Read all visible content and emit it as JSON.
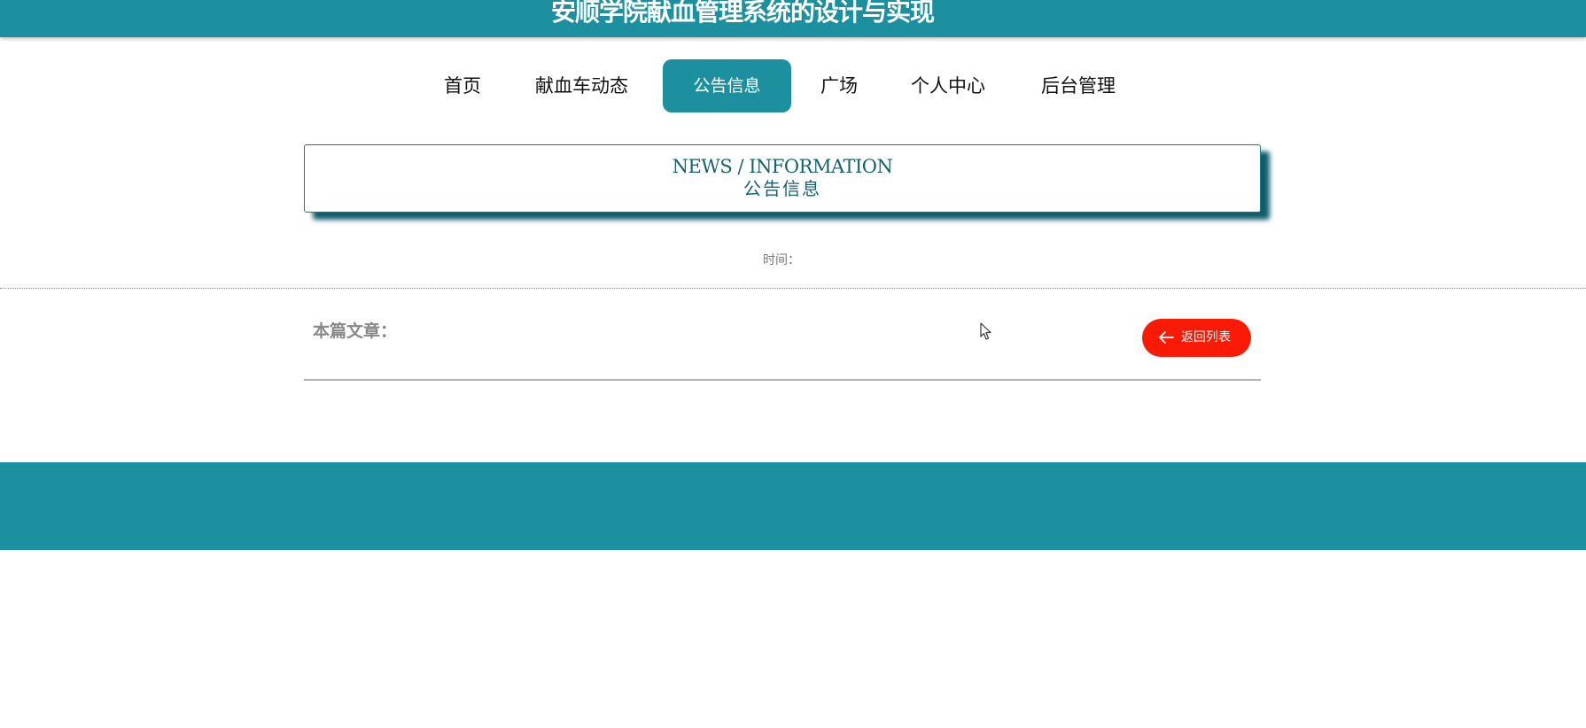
{
  "header": {
    "title": "安顺学院献血管理系统的设计与实现"
  },
  "nav": {
    "items": [
      {
        "label": "首页"
      },
      {
        "label": "献血车动态"
      },
      {
        "label": "公告信息",
        "active": true
      },
      {
        "label": "广场"
      },
      {
        "label": "个人中心"
      },
      {
        "label": "后台管理"
      }
    ]
  },
  "section": {
    "title_en": "NEWS / INFORMATION",
    "title_cn": "公告信息"
  },
  "article": {
    "time_label": "时间：",
    "current_label": "本篇文章：",
    "back_button_label": "返回列表",
    "back_icon": "arrow-left-icon"
  },
  "colors": {
    "primary": "#1d909f",
    "accent_button": "#fb1a05",
    "section_text": "#18626f"
  }
}
